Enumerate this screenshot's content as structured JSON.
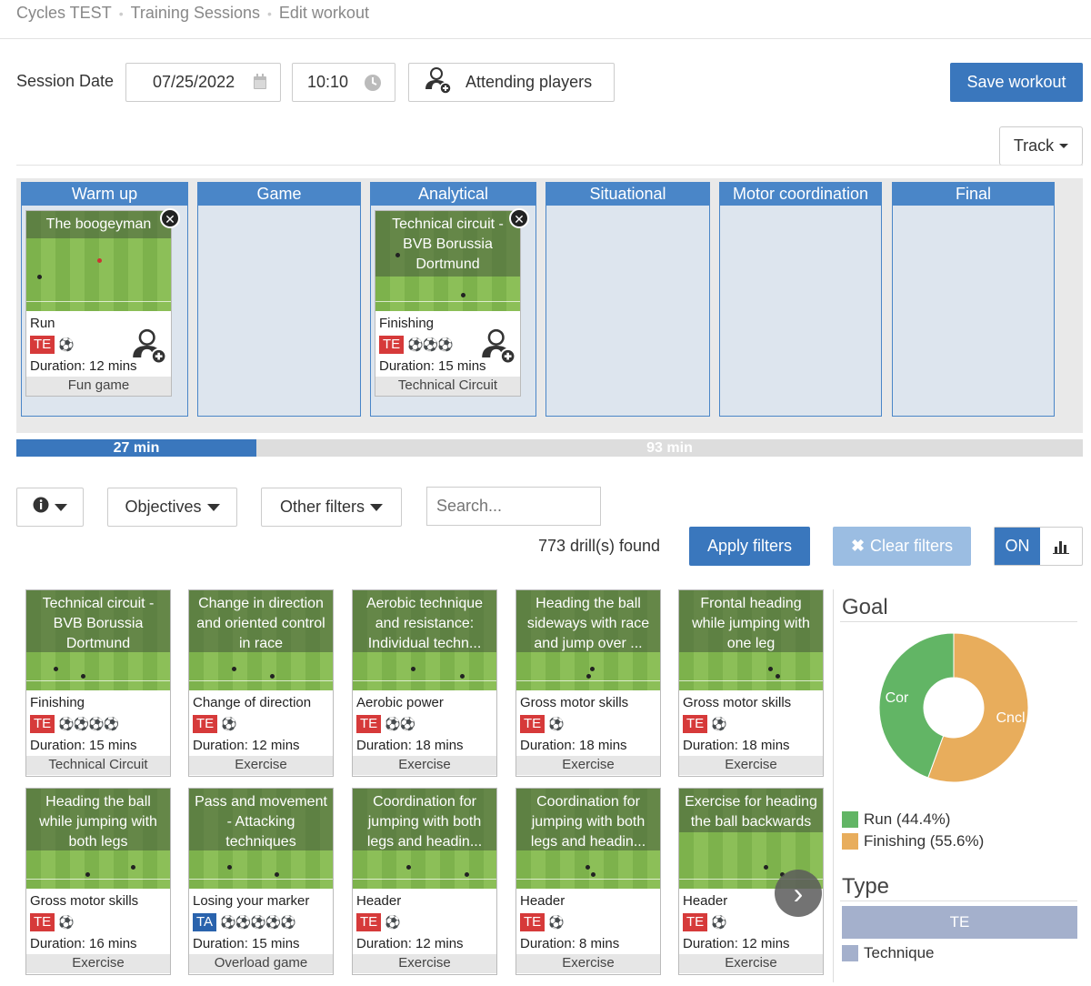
{
  "breadcrumb": [
    "Cycles TEST",
    "Training Sessions",
    "Edit workout"
  ],
  "session": {
    "label": "Session Date",
    "date": "07/25/2022",
    "time": "10:10",
    "attending_label": "Attending players",
    "save_label": "Save workout",
    "track_label": "Track"
  },
  "phases": [
    {
      "name": "Warm up",
      "card": {
        "title": "The boogeyman",
        "category": "Run",
        "tag": "TE",
        "balls": 1,
        "duration": "Duration: 12 mins",
        "type": "Fun game"
      }
    },
    {
      "name": "Game"
    },
    {
      "name": "Analytical",
      "card": {
        "title": "Technical circuit - BVB Borussia Dortmund",
        "category": "Finishing",
        "tag": "TE",
        "balls": 3,
        "duration": "Duration: 15 mins",
        "type": "Technical Circuit"
      }
    },
    {
      "name": "Situational"
    },
    {
      "name": "Motor coordination"
    },
    {
      "name": "Final"
    }
  ],
  "progress": {
    "used": "27 min",
    "remaining": "93 min",
    "fraction": 0.225
  },
  "filters": {
    "objectives_label": "Objectives",
    "other_label": "Other filters",
    "search_placeholder": "Search...",
    "found": "773 drill(s) found",
    "apply_label": "Apply filters",
    "clear_label": "Clear filters",
    "toggle_on": "ON"
  },
  "drills": [
    {
      "title": "Technical circuit - BVB Borussia Dortmund",
      "category": "Finishing",
      "tag": "TE",
      "balls": 4,
      "duration": "Duration: 15 mins",
      "type": "Technical Circuit"
    },
    {
      "title": "Change in direction and oriented control in race",
      "category": "Change of direction",
      "tag": "TE",
      "balls": 1,
      "duration": "Duration: 12 mins",
      "type": "Exercise"
    },
    {
      "title": "Aerobic technique and resistance: Individual techn...",
      "category": "Aerobic power",
      "tag": "TE",
      "balls": 2,
      "duration": "Duration: 18 mins",
      "type": "Exercise"
    },
    {
      "title": "Heading the ball sideways with race and jump over ...",
      "category": "Gross motor skills",
      "tag": "TE",
      "balls": 1,
      "duration": "Duration: 18 mins",
      "type": "Exercise"
    },
    {
      "title": "Frontal heading while jumping with one leg",
      "category": "Gross motor skills",
      "tag": "TE",
      "balls": 1,
      "duration": "Duration: 18 mins",
      "type": "Exercise"
    },
    {
      "title": "Heading the ball while jumping with both legs",
      "category": "Gross motor skills",
      "tag": "TE",
      "balls": 1,
      "duration": "Duration: 16 mins",
      "type": "Exercise"
    },
    {
      "title": "Pass and movement - Attacking techniques",
      "category": "Losing your marker",
      "tag": "TA",
      "balls": 5,
      "duration": "Duration: 15 mins",
      "type": "Overload game"
    },
    {
      "title": "Coordination for jumping with both legs and headin...",
      "category": "Header",
      "tag": "TE",
      "balls": 1,
      "duration": "Duration: 12 mins",
      "type": "Exercise"
    },
    {
      "title": "Coordination for jumping with both legs and headin...",
      "category": "Header",
      "tag": "TE",
      "balls": 1,
      "duration": "Duration: 8 mins",
      "type": "Exercise"
    },
    {
      "title": "Exercise for heading the ball backwards",
      "category": "Header",
      "tag": "TE",
      "balls": 1,
      "duration": "Duration: 12 mins",
      "type": "Exercise"
    }
  ],
  "goal": {
    "title": "Goal",
    "chart_data": {
      "type": "pie",
      "categories": [
        "Run",
        "Finishing"
      ],
      "values": [
        44.4,
        55.6
      ],
      "slice_labels": [
        "Cor",
        "Cncl"
      ],
      "colors": [
        "#62b565",
        "#e8ad5c"
      ]
    },
    "legend": [
      "Run (44.4%)",
      "Finishing (55.6%)"
    ]
  },
  "type_section": {
    "title": "Type",
    "bar_label": "TE",
    "bar_color": "#a4b0cc",
    "legend": "Technique"
  }
}
